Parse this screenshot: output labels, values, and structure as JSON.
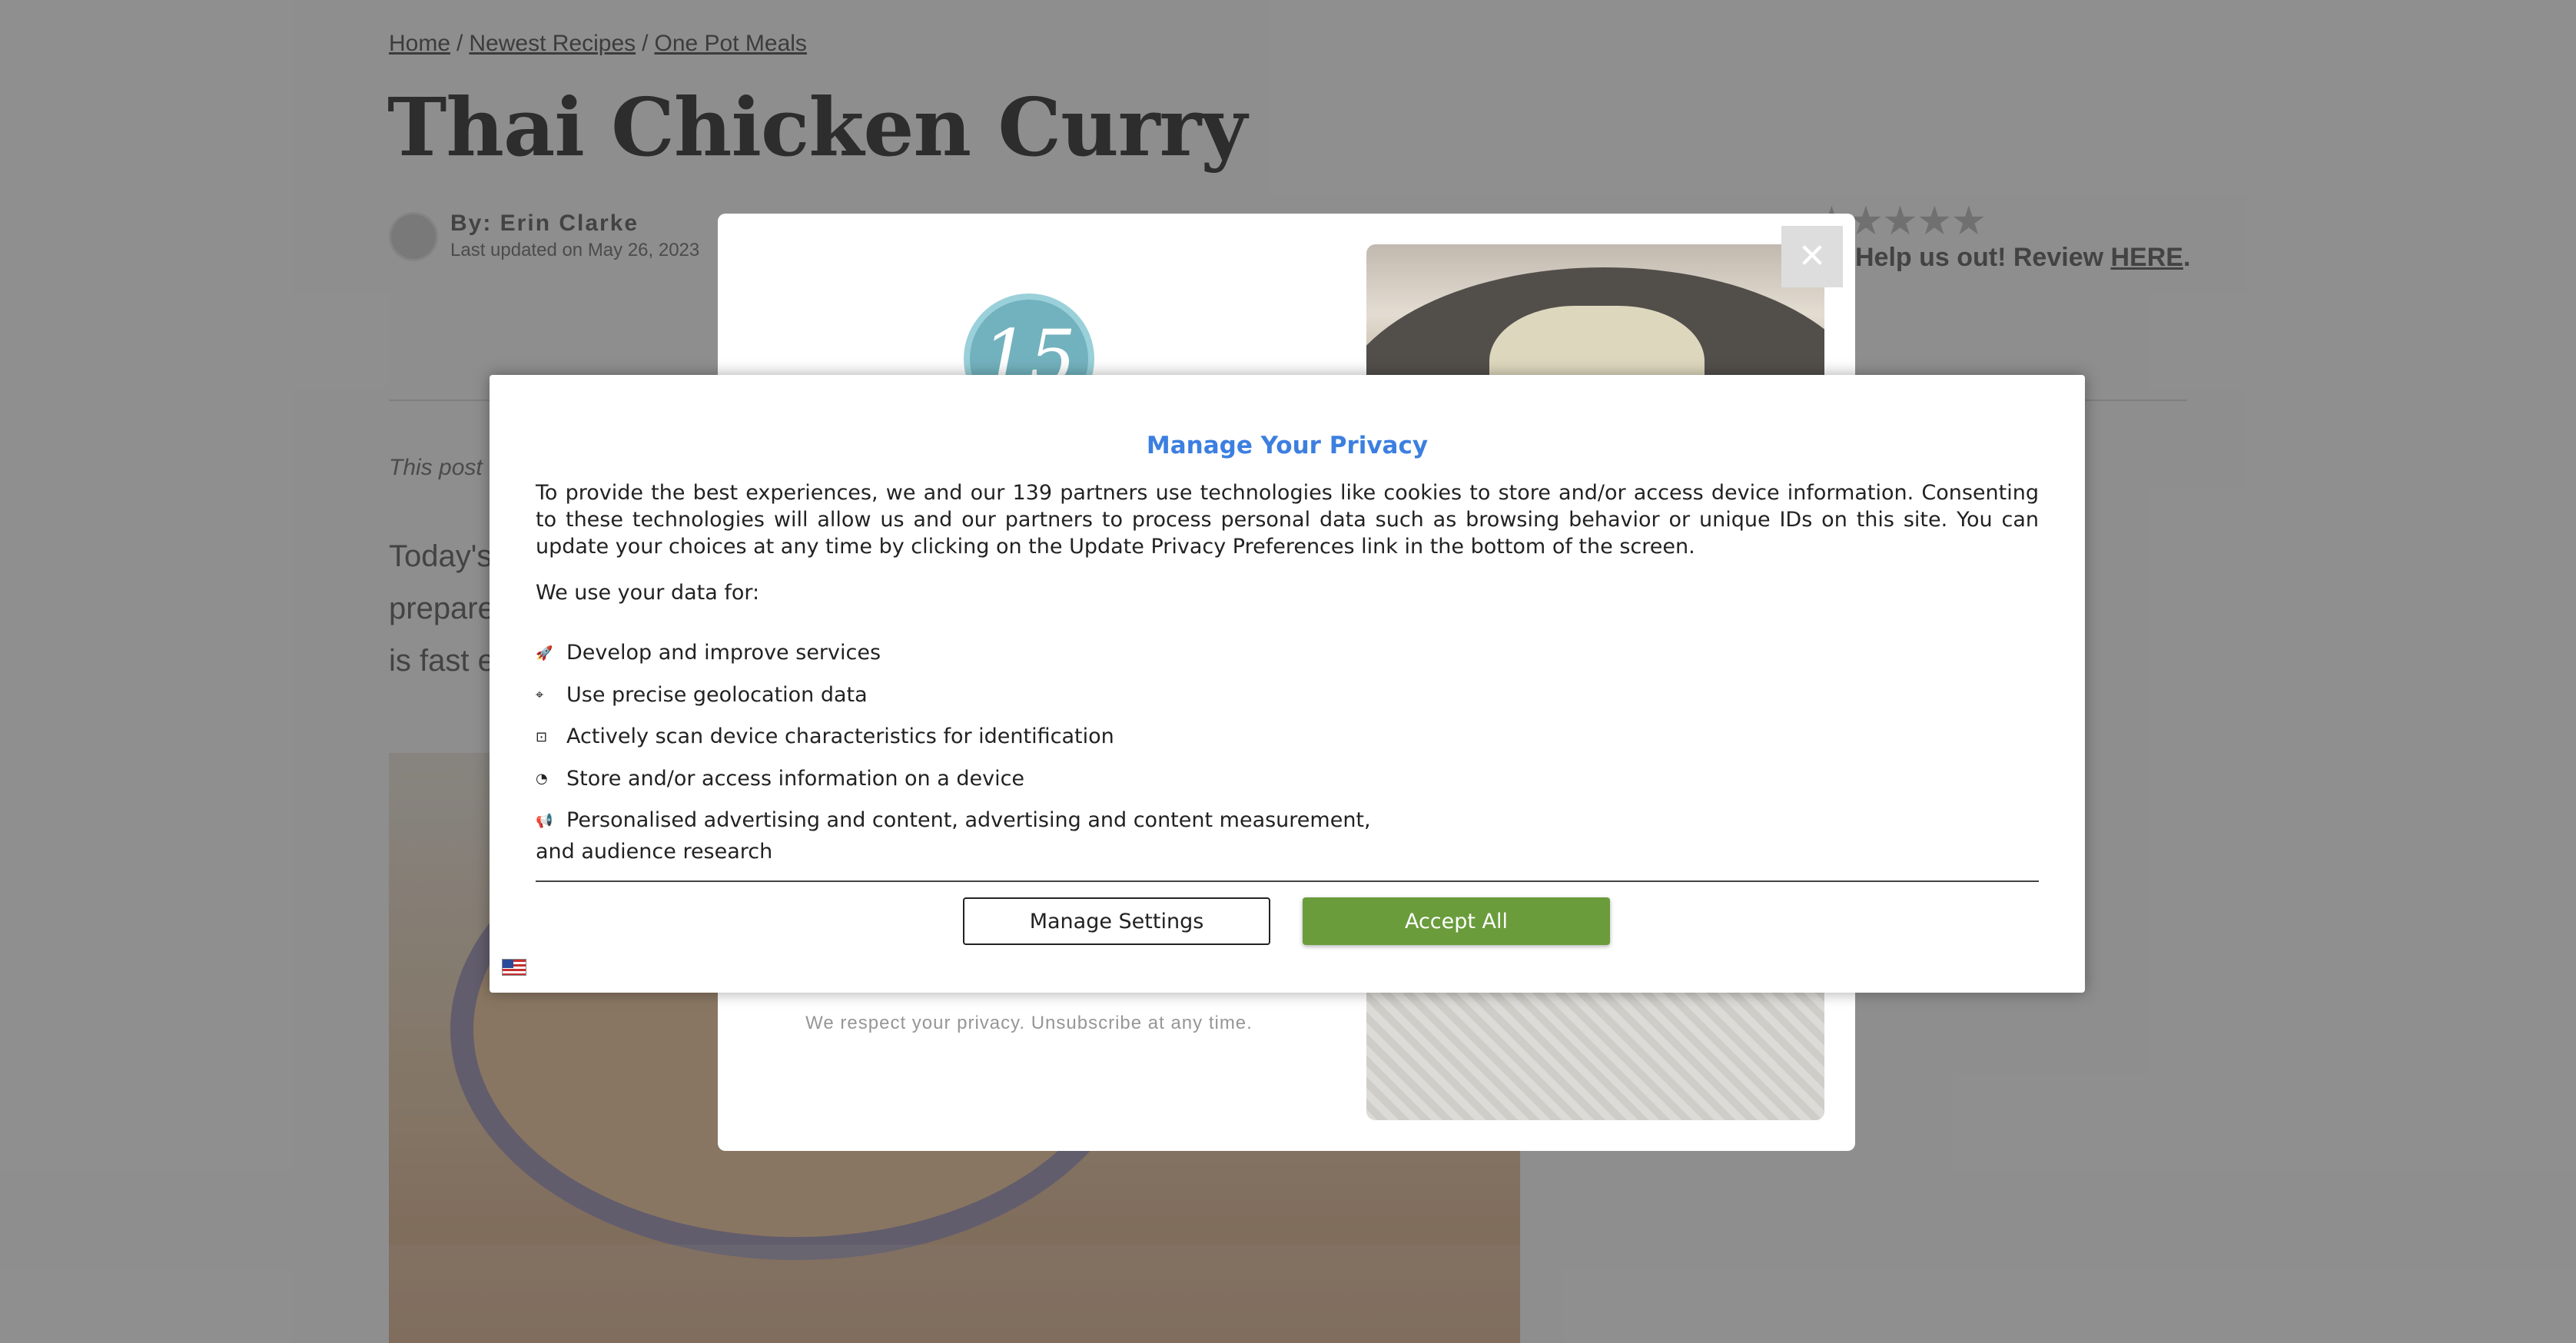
{
  "breadcrumb": {
    "items": [
      "Home",
      "Newest Recipes",
      "One Pot Meals"
    ],
    "separator": "/"
  },
  "page": {
    "title": "Thai Chicken Curry",
    "byline": "By: Erin Clarke",
    "updated": "Last updated on May 26, 2023",
    "stars": "★★★★★",
    "review_prefix": "Help us out! Review ",
    "review_link": "HERE",
    "review_suffix": ".",
    "disclosure": "This post",
    "intro_lines": [
      "Today's",
      "prepare",
      "is fast e"
    ]
  },
  "newsletter": {
    "badge": "15",
    "privacy_note": "We respect your privacy. Unsubscribe at any time.",
    "close_symbol": "✕"
  },
  "consent": {
    "heading": "Manage Your Privacy",
    "description": "To provide the best experiences, we and our 139 partners use technologies like cookies to store and/or access device information. Consenting to these technologies will allow us and our partners to process personal data such as browsing behavior or unique IDs on this site. You can update your choices at any time by clicking on the Update Privacy Preferences link in the bottom of the screen.",
    "use_label": "We use your data for:",
    "purposes": [
      {
        "icon": "rocket-icon",
        "glyph": "🚀",
        "label": "Develop and improve services"
      },
      {
        "icon": "location-pin-icon",
        "glyph": "⌖",
        "label": "Use precise geolocation data"
      },
      {
        "icon": "scan-icon",
        "glyph": "⊡",
        "label": "Actively scan device characteristics for identification"
      },
      {
        "icon": "cookie-icon",
        "glyph": "◔",
        "label": "Store and/or access information on a device"
      },
      {
        "icon": "megaphone-icon",
        "glyph": "📢",
        "label": "Personalised advertising and content, advertising and content measurement, and audience research"
      }
    ],
    "manage_settings": "Manage Settings",
    "accept_all": "Accept All",
    "accent_color": "#3c7fe0",
    "accept_color": "#6a9c3c"
  }
}
